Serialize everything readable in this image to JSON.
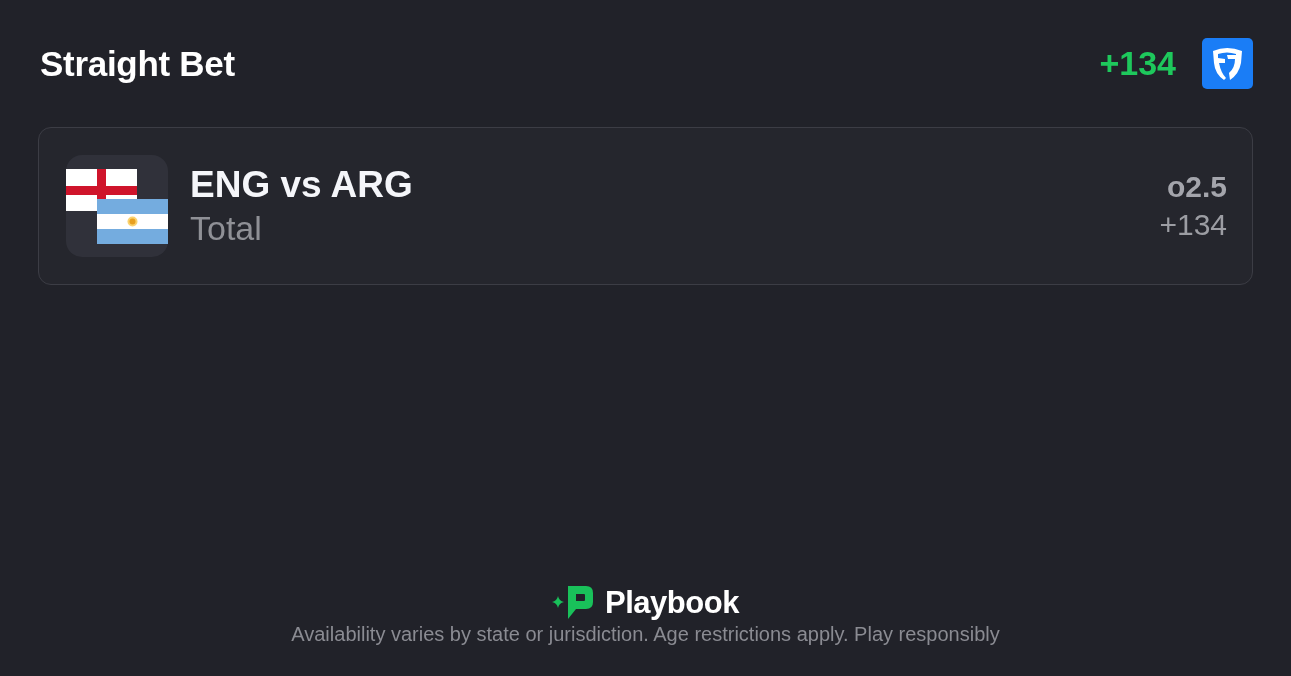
{
  "header": {
    "title": "Straight Bet",
    "odds": "+134"
  },
  "bet": {
    "matchup": "ENG vs ARG",
    "market": "Total",
    "line": "o2.5",
    "odds": "+134"
  },
  "footer": {
    "brand": "Playbook",
    "disclaimer": "Availability varies by state or jurisdiction. Age restrictions apply. Play responsibly"
  }
}
